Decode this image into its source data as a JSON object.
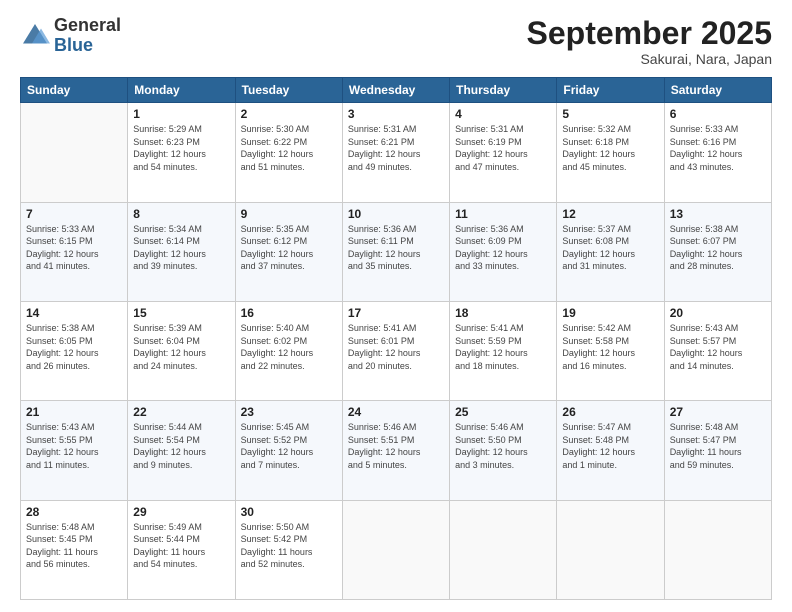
{
  "header": {
    "logo": {
      "general": "General",
      "blue": "Blue"
    },
    "title": "September 2025",
    "subtitle": "Sakurai, Nara, Japan"
  },
  "weekdays": [
    "Sunday",
    "Monday",
    "Tuesday",
    "Wednesday",
    "Thursday",
    "Friday",
    "Saturday"
  ],
  "weeks": [
    [
      {
        "day": "",
        "info": ""
      },
      {
        "day": "1",
        "info": "Sunrise: 5:29 AM\nSunset: 6:23 PM\nDaylight: 12 hours\nand 54 minutes."
      },
      {
        "day": "2",
        "info": "Sunrise: 5:30 AM\nSunset: 6:22 PM\nDaylight: 12 hours\nand 51 minutes."
      },
      {
        "day": "3",
        "info": "Sunrise: 5:31 AM\nSunset: 6:21 PM\nDaylight: 12 hours\nand 49 minutes."
      },
      {
        "day": "4",
        "info": "Sunrise: 5:31 AM\nSunset: 6:19 PM\nDaylight: 12 hours\nand 47 minutes."
      },
      {
        "day": "5",
        "info": "Sunrise: 5:32 AM\nSunset: 6:18 PM\nDaylight: 12 hours\nand 45 minutes."
      },
      {
        "day": "6",
        "info": "Sunrise: 5:33 AM\nSunset: 6:16 PM\nDaylight: 12 hours\nand 43 minutes."
      }
    ],
    [
      {
        "day": "7",
        "info": "Sunrise: 5:33 AM\nSunset: 6:15 PM\nDaylight: 12 hours\nand 41 minutes."
      },
      {
        "day": "8",
        "info": "Sunrise: 5:34 AM\nSunset: 6:14 PM\nDaylight: 12 hours\nand 39 minutes."
      },
      {
        "day": "9",
        "info": "Sunrise: 5:35 AM\nSunset: 6:12 PM\nDaylight: 12 hours\nand 37 minutes."
      },
      {
        "day": "10",
        "info": "Sunrise: 5:36 AM\nSunset: 6:11 PM\nDaylight: 12 hours\nand 35 minutes."
      },
      {
        "day": "11",
        "info": "Sunrise: 5:36 AM\nSunset: 6:09 PM\nDaylight: 12 hours\nand 33 minutes."
      },
      {
        "day": "12",
        "info": "Sunrise: 5:37 AM\nSunset: 6:08 PM\nDaylight: 12 hours\nand 31 minutes."
      },
      {
        "day": "13",
        "info": "Sunrise: 5:38 AM\nSunset: 6:07 PM\nDaylight: 12 hours\nand 28 minutes."
      }
    ],
    [
      {
        "day": "14",
        "info": "Sunrise: 5:38 AM\nSunset: 6:05 PM\nDaylight: 12 hours\nand 26 minutes."
      },
      {
        "day": "15",
        "info": "Sunrise: 5:39 AM\nSunset: 6:04 PM\nDaylight: 12 hours\nand 24 minutes."
      },
      {
        "day": "16",
        "info": "Sunrise: 5:40 AM\nSunset: 6:02 PM\nDaylight: 12 hours\nand 22 minutes."
      },
      {
        "day": "17",
        "info": "Sunrise: 5:41 AM\nSunset: 6:01 PM\nDaylight: 12 hours\nand 20 minutes."
      },
      {
        "day": "18",
        "info": "Sunrise: 5:41 AM\nSunset: 5:59 PM\nDaylight: 12 hours\nand 18 minutes."
      },
      {
        "day": "19",
        "info": "Sunrise: 5:42 AM\nSunset: 5:58 PM\nDaylight: 12 hours\nand 16 minutes."
      },
      {
        "day": "20",
        "info": "Sunrise: 5:43 AM\nSunset: 5:57 PM\nDaylight: 12 hours\nand 14 minutes."
      }
    ],
    [
      {
        "day": "21",
        "info": "Sunrise: 5:43 AM\nSunset: 5:55 PM\nDaylight: 12 hours\nand 11 minutes."
      },
      {
        "day": "22",
        "info": "Sunrise: 5:44 AM\nSunset: 5:54 PM\nDaylight: 12 hours\nand 9 minutes."
      },
      {
        "day": "23",
        "info": "Sunrise: 5:45 AM\nSunset: 5:52 PM\nDaylight: 12 hours\nand 7 minutes."
      },
      {
        "day": "24",
        "info": "Sunrise: 5:46 AM\nSunset: 5:51 PM\nDaylight: 12 hours\nand 5 minutes."
      },
      {
        "day": "25",
        "info": "Sunrise: 5:46 AM\nSunset: 5:50 PM\nDaylight: 12 hours\nand 3 minutes."
      },
      {
        "day": "26",
        "info": "Sunrise: 5:47 AM\nSunset: 5:48 PM\nDaylight: 12 hours\nand 1 minute."
      },
      {
        "day": "27",
        "info": "Sunrise: 5:48 AM\nSunset: 5:47 PM\nDaylight: 11 hours\nand 59 minutes."
      }
    ],
    [
      {
        "day": "28",
        "info": "Sunrise: 5:48 AM\nSunset: 5:45 PM\nDaylight: 11 hours\nand 56 minutes."
      },
      {
        "day": "29",
        "info": "Sunrise: 5:49 AM\nSunset: 5:44 PM\nDaylight: 11 hours\nand 54 minutes."
      },
      {
        "day": "30",
        "info": "Sunrise: 5:50 AM\nSunset: 5:42 PM\nDaylight: 11 hours\nand 52 minutes."
      },
      {
        "day": "",
        "info": ""
      },
      {
        "day": "",
        "info": ""
      },
      {
        "day": "",
        "info": ""
      },
      {
        "day": "",
        "info": ""
      }
    ]
  ]
}
